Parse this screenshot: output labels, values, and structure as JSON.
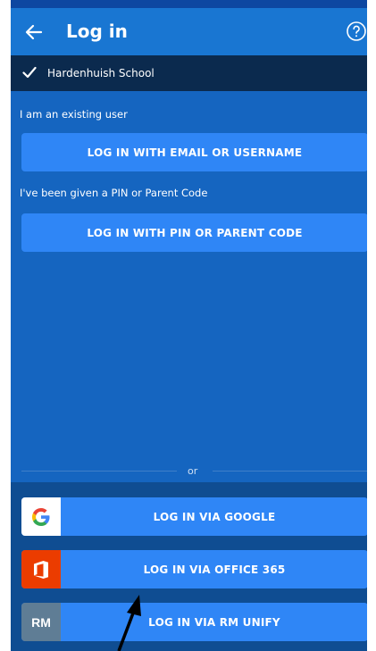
{
  "header": {
    "title": "Log in"
  },
  "school": {
    "name": "Hardenhuish School"
  },
  "existing": {
    "label": "I am an existing user",
    "button": "LOG IN WITH EMAIL OR USERNAME"
  },
  "pin": {
    "label": "I've been given a PIN or Parent Code",
    "button": "LOG IN WITH PIN OR PARENT CODE"
  },
  "separator": "or",
  "sso": [
    {
      "label": "LOG IN VIA GOOGLE",
      "icon": "google-icon",
      "icon_bg": "#ffffff"
    },
    {
      "label": "LOG IN VIA OFFICE 365",
      "icon": "office-365-icon",
      "icon_bg": "#eb3c00"
    },
    {
      "label": "LOG IN VIA RM UNIFY",
      "icon": "rm-unify-icon",
      "icon_text": "RM",
      "icon_bg": "#5f7d95"
    }
  ],
  "colors": {
    "appbar": "#1976d2",
    "school_bar": "#0b2a4e",
    "content": "#1565c0",
    "button": "#2f86f6",
    "sso_area": "#0f4d92"
  }
}
